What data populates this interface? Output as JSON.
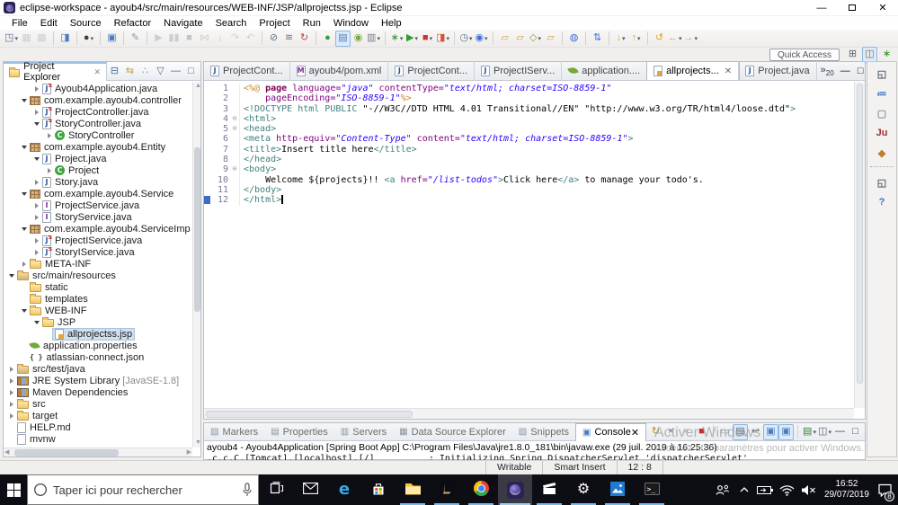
{
  "window": {
    "title": "eclipse-workspace - ayoub4/src/main/resources/WEB-INF/JSP/allprojectss.jsp - Eclipse"
  },
  "menu": [
    "File",
    "Edit",
    "Source",
    "Refactor",
    "Navigate",
    "Search",
    "Project",
    "Run",
    "Window",
    "Help"
  ],
  "toolbar": {
    "icons": [
      {
        "name": "new-wizard",
        "glyph": "◳",
        "color": "#5b6c8f",
        "dropdown": true
      },
      {
        "name": "save",
        "glyph": "▦",
        "color": "#8e9aa6",
        "disabled": true
      },
      {
        "name": "save-all",
        "glyph": "▩",
        "color": "#8e9aa6",
        "disabled": true
      },
      {
        "sep": true
      },
      {
        "name": "web-doc",
        "glyph": "◨",
        "color": "#4a7dbd"
      },
      {
        "sep": true
      },
      {
        "name": "user-profile",
        "glyph": "●",
        "color": "#3d3d3d",
        "dropdown": true
      },
      {
        "sep": true
      },
      {
        "name": "remote-screen",
        "glyph": "▣",
        "color": "#4a7dbd"
      },
      {
        "sep": true
      },
      {
        "name": "no-edit",
        "glyph": "✎",
        "color": "#8899aa"
      },
      {
        "sep": true
      },
      {
        "name": "resume",
        "glyph": "▶",
        "color": "#8e9aa6",
        "disabled": true
      },
      {
        "name": "suspend",
        "glyph": "▮▮",
        "color": "#8e9aa6",
        "disabled": true
      },
      {
        "name": "terminate-debug",
        "glyph": "■",
        "color": "#76828e",
        "disabled": true
      },
      {
        "name": "disconnect",
        "glyph": "⋈",
        "color": "#8e9aa6",
        "disabled": true
      },
      {
        "name": "step-into",
        "glyph": "↓",
        "color": "#8e9aa6",
        "disabled": true
      },
      {
        "name": "step-over",
        "glyph": "↷",
        "color": "#8e9aa6",
        "disabled": true
      },
      {
        "name": "step-return",
        "glyph": "↶",
        "color": "#8e9aa6",
        "disabled": true
      },
      {
        "sep": true
      },
      {
        "name": "skip-breakpoints",
        "glyph": "⊘",
        "color": "#667788"
      },
      {
        "name": "filter-launches",
        "glyph": "≋",
        "color": "#667788"
      },
      {
        "name": "relaunch",
        "glyph": "↻",
        "color": "#bb4444"
      },
      {
        "sep": true
      },
      {
        "name": "spring-run",
        "glyph": "●",
        "color": "#2e9e3e"
      },
      {
        "name": "boot-dashboard",
        "glyph": "▤",
        "color": "#4a7dbd",
        "active": true
      },
      {
        "name": "spring-leaf",
        "glyph": "◉",
        "color": "#6fae3d"
      },
      {
        "name": "server-tools",
        "glyph": "▥",
        "color": "#77808a",
        "dropdown": true
      },
      {
        "sep": true
      },
      {
        "name": "debug",
        "glyph": "∗",
        "color": "#2e8f2e",
        "dropdown": true
      },
      {
        "name": "run",
        "glyph": "▶",
        "color": "#2e9e2e",
        "dropdown": true
      },
      {
        "name": "terminate-launch",
        "glyph": "■",
        "color": "#cc3333",
        "dropdown": true
      },
      {
        "name": "run-last",
        "glyph": "◨",
        "color": "#cc5533",
        "dropdown": true
      },
      {
        "sep": true
      },
      {
        "name": "web-service",
        "glyph": "◷",
        "color": "#556b8f",
        "dropdown": true
      },
      {
        "name": "webservice-explorer",
        "glyph": "◉",
        "color": "#3b6fd4",
        "dropdown": true
      },
      {
        "sep": true
      },
      {
        "name": "import-folder",
        "glyph": "▱",
        "color": "#c9a24a"
      },
      {
        "name": "export-folder",
        "glyph": "▱",
        "color": "#c9a24a"
      },
      {
        "name": "open-resource",
        "glyph": "◇",
        "color": "#b08a3e",
        "dropdown": true
      },
      {
        "name": "new-folder",
        "glyph": "▱",
        "color": "#c9a24a"
      },
      {
        "sep": true
      },
      {
        "name": "web-browser",
        "glyph": "◍",
        "color": "#3b6fd4"
      },
      {
        "sep": true
      },
      {
        "name": "team-sync",
        "glyph": "⇅",
        "color": "#3b6fd4"
      },
      {
        "sep": true
      },
      {
        "name": "import",
        "glyph": "↓",
        "color": "#d9a326",
        "dropdown": true
      },
      {
        "name": "export",
        "glyph": "↑",
        "color": "#d9a326",
        "dropdown": true
      },
      {
        "sep": true
      },
      {
        "name": "last-edit",
        "glyph": "↺",
        "color": "#d9a326"
      },
      {
        "name": "back",
        "glyph": "←",
        "color": "#d9a326",
        "dropdown": true
      },
      {
        "name": "forward",
        "glyph": "→",
        "color": "#9fabb7",
        "dropdown": true
      }
    ]
  },
  "perspective": {
    "quick_access": "Quick Access",
    "icons": [
      {
        "name": "open-perspective",
        "glyph": "⊞",
        "color": "#5a6470"
      },
      {
        "name": "javaee-perspective",
        "glyph": "◫",
        "color": "#8a6d3b",
        "active": true
      },
      {
        "name": "debug-perspective",
        "glyph": "∗",
        "color": "#2e8f2e"
      }
    ]
  },
  "explorer": {
    "title": "Project Explorer",
    "toolbar": [
      {
        "name": "collapse-all",
        "glyph": "⊟",
        "color": "#4a6c9b"
      },
      {
        "name": "link-with-editor",
        "glyph": "⇆",
        "color": "#c9a24a"
      },
      {
        "name": "filters",
        "glyph": "∴",
        "color": "#8a94a0"
      },
      {
        "name": "view-menu",
        "glyph": "▽",
        "color": "#5a6470"
      },
      {
        "name": "minimize-view",
        "glyph": "—",
        "color": "#5a6470"
      },
      {
        "name": "maximize-view",
        "glyph": "□",
        "color": "#5a6470"
      }
    ],
    "tree": [
      {
        "label": "Ayoub4Application.java",
        "level": 3,
        "arrow": "c",
        "icon": "javas"
      },
      {
        "label": "com.example.ayoub4.controller",
        "level": 2,
        "arrow": "e",
        "icon": "pkg"
      },
      {
        "label": "ProjectController.java",
        "level": 3,
        "arrow": "c",
        "icon": "javas"
      },
      {
        "label": "StoryController.java",
        "level": 3,
        "arrow": "e",
        "icon": "javas"
      },
      {
        "label": "StoryController",
        "level": 4,
        "arrow": "c",
        "icon": "classC"
      },
      {
        "label": "com.example.ayoub4.Entity",
        "level": 2,
        "arrow": "e",
        "icon": "pkg"
      },
      {
        "label": "Project.java",
        "level": 3,
        "arrow": "e",
        "icon": "java"
      },
      {
        "label": "Project",
        "level": 4,
        "arrow": "c",
        "icon": "classC"
      },
      {
        "label": "Story.java",
        "level": 3,
        "arrow": "c",
        "icon": "java"
      },
      {
        "label": "com.example.ayoub4.Service",
        "level": 2,
        "arrow": "e",
        "icon": "pkg"
      },
      {
        "label": "ProjectService.java",
        "level": 3,
        "arrow": "c",
        "icon": "javai"
      },
      {
        "label": "StoryService.java",
        "level": 3,
        "arrow": "c",
        "icon": "javai"
      },
      {
        "label": "com.example.ayoub4.ServiceImp",
        "level": 2,
        "arrow": "e",
        "icon": "pkg"
      },
      {
        "label": "ProjectIService.java",
        "level": 3,
        "arrow": "c",
        "icon": "javas"
      },
      {
        "label": "StoryIService.java",
        "level": 3,
        "arrow": "c",
        "icon": "javas"
      },
      {
        "label": "META-INF",
        "level": 2,
        "arrow": "c",
        "icon": "folder"
      },
      {
        "label": "src/main/resources",
        "level": 1,
        "arrow": "e",
        "icon": "srcpkg"
      },
      {
        "label": "static",
        "level": 2,
        "arrow": "",
        "icon": "folder"
      },
      {
        "label": "templates",
        "level": 2,
        "arrow": "",
        "icon": "folder"
      },
      {
        "label": "WEB-INF",
        "level": 2,
        "arrow": "e",
        "icon": "folder"
      },
      {
        "label": "JSP",
        "level": 3,
        "arrow": "e",
        "icon": "folder"
      },
      {
        "label": "allprojectss.jsp",
        "level": 4,
        "arrow": "",
        "icon": "jsp",
        "selected": true
      },
      {
        "label": "application.properties",
        "level": 2,
        "arrow": "",
        "icon": "leaf"
      },
      {
        "label": "atlassian-connect.json",
        "level": 2,
        "arrow": "",
        "icon": "json"
      },
      {
        "label": "src/test/java",
        "level": 1,
        "arrow": "c",
        "icon": "srcpkg"
      },
      {
        "label": "JRE System Library",
        "suffix": "[JavaSE-1.8]",
        "level": 1,
        "arrow": "c",
        "icon": "lib"
      },
      {
        "label": "Maven Dependencies",
        "level": 1,
        "arrow": "c",
        "icon": "lib"
      },
      {
        "label": "src",
        "level": 1,
        "arrow": "c",
        "icon": "folder"
      },
      {
        "label": "target",
        "level": 1,
        "arrow": "c",
        "icon": "folder"
      },
      {
        "label": "HELP.md",
        "level": 1,
        "arrow": "",
        "icon": "file"
      },
      {
        "label": "mvnw",
        "level": 1,
        "arrow": "",
        "icon": "file"
      }
    ]
  },
  "editor": {
    "tabs": [
      {
        "label": "ProjectCont...",
        "icon": "java"
      },
      {
        "label": "ayoub4/pom.xml",
        "icon": "maven"
      },
      {
        "label": "ProjectCont...",
        "icon": "java"
      },
      {
        "label": "ProjectIServ...",
        "icon": "java"
      },
      {
        "label": "application....",
        "icon": "leaf"
      },
      {
        "label": "allprojects...",
        "icon": "jsp",
        "active": true
      },
      {
        "label": "Project.java",
        "icon": "java"
      }
    ],
    "overflow_glyph": "»",
    "overflow_count": "20",
    "code": [
      {
        "n": "1",
        "segs": [
          [
            "<%@ ",
            "jspd"
          ],
          [
            "page ",
            "kw"
          ],
          [
            "language=",
            "attr"
          ],
          [
            "\"java\"",
            "val"
          ],
          [
            " ",
            "plain"
          ],
          [
            "contentType=",
            "attr"
          ],
          [
            "\"text/html; charset=ISO-8859-1\"",
            "val"
          ]
        ]
      },
      {
        "n": "2",
        "segs": [
          [
            "    pageEncoding=",
            "attr"
          ],
          [
            "\"ISO-8859-1\"",
            "val"
          ],
          [
            "%>",
            "jspd"
          ]
        ]
      },
      {
        "n": "3",
        "segs": [
          [
            "<!DOCTYPE html PUBLIC ",
            "tag"
          ],
          [
            "\"-//W3C//DTD HTML 4.01 Transitional//EN\" \"http://www.w3.org/TR/html4/loose.dtd\"",
            "plain"
          ],
          [
            ">",
            "tag"
          ]
        ]
      },
      {
        "n": "4",
        "fold": true,
        "segs": [
          [
            "<html>",
            "tag"
          ]
        ]
      },
      {
        "n": "5",
        "fold": true,
        "segs": [
          [
            "<head>",
            "tag"
          ]
        ]
      },
      {
        "n": "6",
        "segs": [
          [
            "<meta ",
            "tag"
          ],
          [
            "http-equiv=",
            "attr"
          ],
          [
            "\"Content-Type\"",
            "val"
          ],
          [
            " ",
            "plain"
          ],
          [
            "content=",
            "attr"
          ],
          [
            "\"text/html; charset=ISO-8859-1\"",
            "val"
          ],
          [
            ">",
            "tag"
          ]
        ]
      },
      {
        "n": "7",
        "segs": [
          [
            "<title>",
            "tag"
          ],
          [
            "Insert title here",
            "plain"
          ],
          [
            "</title>",
            "tag"
          ]
        ]
      },
      {
        "n": "8",
        "segs": [
          [
            "</head>",
            "tag"
          ]
        ]
      },
      {
        "n": "9",
        "fold": true,
        "segs": [
          [
            "<body>",
            "tag"
          ]
        ]
      },
      {
        "n": "10",
        "segs": [
          [
            "    Welcome ${projects}!! ",
            "plain"
          ],
          [
            "<a ",
            "tag"
          ],
          [
            "href=",
            "attr"
          ],
          [
            "\"/list-todos\"",
            "val"
          ],
          [
            ">",
            "tag"
          ],
          [
            "Click here",
            "plain"
          ],
          [
            "</a>",
            "tag"
          ],
          [
            " to manage your todo's.",
            "plain"
          ]
        ]
      },
      {
        "n": "11",
        "segs": [
          [
            "</body>",
            "tag"
          ]
        ]
      },
      {
        "n": "12",
        "cur": true,
        "caret": true,
        "segs": [
          [
            "</html>",
            "tag"
          ]
        ]
      }
    ]
  },
  "rightstrip": [
    {
      "name": "restore-right-views",
      "glyph": "◱",
      "color": "#5a6470"
    },
    {
      "name": "outline-view",
      "glyph": "≔",
      "color": "#4a7dbd"
    },
    {
      "name": "task-list-view",
      "glyph": "▢",
      "color": "#8a94a0"
    },
    {
      "name": "junit-view",
      "glyph": "Ju",
      "color": "#9e2f2f"
    },
    {
      "name": "oomph-view",
      "glyph": "◆",
      "color": "#c07f2a"
    },
    {
      "divider": true
    },
    {
      "name": "restore-help-views",
      "glyph": "◱",
      "color": "#5a6470"
    },
    {
      "name": "help-view",
      "glyph": "?",
      "color": "#3b6fd4"
    }
  ],
  "bottom": {
    "tabs": [
      {
        "label": "Markers",
        "icon": "markers",
        "glyph": "▨"
      },
      {
        "label": "Properties",
        "icon": "properties",
        "glyph": "▤"
      },
      {
        "label": "Servers",
        "icon": "servers",
        "glyph": "▥"
      },
      {
        "label": "Data Source Explorer",
        "icon": "datasource",
        "glyph": "▦"
      },
      {
        "label": "Snippets",
        "icon": "snippets",
        "glyph": "▧"
      },
      {
        "label": "Console",
        "icon": "console",
        "glyph": "▣",
        "active": true
      }
    ],
    "toolbar": [
      {
        "name": "relaunch-console",
        "glyph": "↻",
        "color": "#c08a1e"
      },
      {
        "name": "remove-launch",
        "glyph": "×",
        "color": "#666677"
      },
      {
        "name": "remove-all-launches",
        "glyph": "×",
        "color": "#a9b2bb"
      },
      {
        "name": "terminate",
        "glyph": "■",
        "color": "#d02b2b"
      },
      {
        "sep": true
      },
      {
        "name": "clear-console",
        "glyph": "▭",
        "color": "#8a94a0"
      },
      {
        "name": "scroll-lock",
        "glyph": "▤",
        "color": "#5a6470",
        "active": true
      },
      {
        "name": "word-wrap",
        "glyph": "↩",
        "color": "#5a6470"
      },
      {
        "name": "show-console-on-stdout",
        "glyph": "▣",
        "color": "#4a7dbd",
        "active": true
      },
      {
        "name": "pin-console",
        "glyph": "▣",
        "color": "#4a7dbd",
        "active": true
      },
      {
        "sep": true
      },
      {
        "name": "display-selected-console",
        "glyph": "▤",
        "color": "#3b7d3b",
        "dropdown": true
      },
      {
        "name": "open-console",
        "glyph": "◫",
        "color": "#5a6470",
        "dropdown": true
      },
      {
        "name": "minimize-panel",
        "glyph": "—",
        "color": "#444"
      },
      {
        "name": "maximize-panel",
        "glyph": "□",
        "color": "#444"
      }
    ],
    "console_line1": "ayoub4 - Ayoub4Application [Spring Boot App] C:\\Program Files\\Java\\jre1.8.0_181\\bin\\javaw.exe (29 juil. 2019 à 16:25:36)",
    "console_line2": ".c.c.C.[Tomcat].[localhost].[/]          : Initializing Spring DispatcherServlet 'dispatcherServlet'"
  },
  "status": {
    "writable": "Writable",
    "insert_mode": "Smart Insert",
    "position": "12 : 8"
  },
  "watermark": {
    "line1": "Activer Windows",
    "line2": "Accédez aux paramètres pour activer Windows."
  },
  "taskbar": {
    "search_placeholder": "Taper ici pour rechercher",
    "apps": [
      {
        "name": "task-view",
        "running": false
      },
      {
        "name": "mail",
        "running": false
      },
      {
        "name": "edge",
        "running": false
      },
      {
        "name": "store",
        "running": false
      },
      {
        "name": "file-explorer",
        "running": true
      },
      {
        "name": "league-of-legends",
        "running": true
      },
      {
        "name": "chrome",
        "running": true
      },
      {
        "name": "eclipse",
        "running": true,
        "active": true
      },
      {
        "name": "movies-tv",
        "running": true
      },
      {
        "name": "settings",
        "running": true
      },
      {
        "name": "photos",
        "running": true
      },
      {
        "name": "terminal",
        "running": true
      }
    ],
    "tray": {
      "time": "16:52",
      "date": "29/07/2019",
      "badge": "8"
    }
  }
}
